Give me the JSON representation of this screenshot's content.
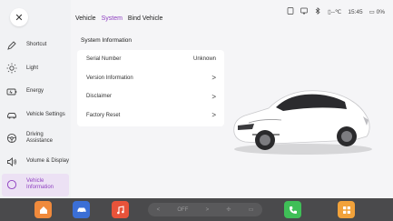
{
  "tabs": [
    {
      "label": "Vehicle"
    },
    {
      "label": "System"
    },
    {
      "label": "Bind Vehicle"
    }
  ],
  "status": {
    "temp": "--℃",
    "time": "15:45",
    "battery": "0%"
  },
  "sidebar": {
    "items": [
      {
        "label": "Shortcut",
        "icon": "pencil-icon"
      },
      {
        "label": "Light",
        "icon": "sun-icon"
      },
      {
        "label": "Energy",
        "icon": "battery-icon"
      },
      {
        "label": "Vehicle Settings",
        "icon": "car-icon"
      },
      {
        "label": "Driving Assistance",
        "icon": "steering-wheel-icon"
      },
      {
        "label": "Volume & Display",
        "icon": "speaker-icon"
      },
      {
        "label": "Vehicle Information",
        "icon": "info-circle-icon"
      }
    ]
  },
  "system_info": {
    "title": "System Information",
    "rows": [
      {
        "label": "Serial Number",
        "value": "Unknown"
      },
      {
        "label": "Version Information",
        "value": ">"
      },
      {
        "label": "Disclaimer",
        "value": ">"
      },
      {
        "label": "Factory Reset",
        "value": ">"
      }
    ]
  },
  "dock": {
    "climate": {
      "left": "<",
      "value": "OFF",
      "right": ">"
    },
    "colors": {
      "home": "#f08a3c",
      "car": "#3b6fd6",
      "music": "#e8533a",
      "phone": "#3fbf57",
      "apps": "#f2a23a"
    }
  }
}
